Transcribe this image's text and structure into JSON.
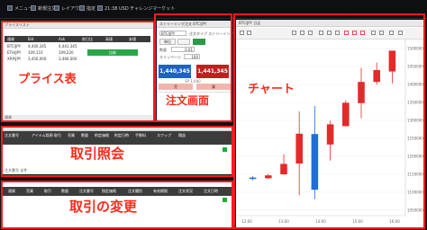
{
  "menubar": {
    "items": [
      {
        "label": "メニュー",
        "icon": "menu-icon"
      },
      {
        "label": "新規注文",
        "icon": "new-order-icon"
      },
      {
        "label": "レイアウト",
        "icon": "layout-icon"
      },
      {
        "label": "指定",
        "icon": "gear-icon"
      },
      {
        "label": "21:38 USD チャレンジマーケット",
        "icon": "clock-icon"
      }
    ]
  },
  "price_panel": {
    "title": "プライスリスト",
    "header_labels": [
      "通貨",
      "Bid",
      "Ask",
      "前日比",
      "高値",
      "安値"
    ],
    "rows": [
      {
        "pair": "BTC/JPY",
        "bid": "4,440,345",
        "ask": "4,441,345",
        "change": "+",
        "high": "",
        "low": ""
      },
      {
        "pair": "ETH/JPY",
        "bid": "109,110",
        "ask": "109,220",
        "change": "",
        "high": "",
        "low": ""
      },
      {
        "pair": "XRP/JPY",
        "bid": "3,456,000",
        "ask": "3,466,000",
        "change": "",
        "high": "",
        "low": ""
      }
    ],
    "tab_label": "通貨",
    "green_label": "比較"
  },
  "order_panel": {
    "title": "ストリーミング注文 BTC/JPY",
    "pair": "BTC/JPY",
    "order_type": "注文タイプ ストリーミング",
    "sell_price": "1,440,345",
    "buy_price": "1,441,345",
    "spread": "SP 1,000",
    "sell_label": "売",
    "buy_label": "買",
    "quantity_label": "数量",
    "quantity_value": "0.01",
    "slippage_label": "スリッページ",
    "slippage_value": "100",
    "unit_label": "単位"
  },
  "torihiki_panel": {
    "title": "約定照会",
    "headers": [
      "注文番号",
      "アイテム銘柄",
      "取引",
      "売買",
      "数量",
      "約定価格",
      "約定日時",
      "手数料",
      "スワップ",
      "損益"
    ],
    "footer": "注文番号 全件"
  },
  "change_panel": {
    "title": "注文の変更",
    "headers": [
      "通貨",
      "売買",
      "取引",
      "数量",
      "注文番号",
      "指定価格",
      "注文種別",
      "有効期限",
      "注文状況",
      "注文日時"
    ]
  },
  "chart_panel": {
    "title": "BTC/JPY 日足",
    "price_labels": [
      "1500000",
      "1450000",
      "1400000",
      "1350000",
      "1300000",
      "1250000",
      "1200000",
      "1150000",
      "1100000",
      "1050000"
    ],
    "time_labels": [
      "12:00",
      "13:00",
      "14:00",
      "15:00",
      "16:00"
    ]
  },
  "captions": {
    "price": "プライス表",
    "order": "注文画面",
    "chart": "チャート",
    "torihiki": "取引照会",
    "change": "取引の変更"
  },
  "chart_data": {
    "type": "candlestick",
    "up_color": "#e32a2a",
    "down_color": "#1f6fd1",
    "candles": [
      {
        "dir": "down",
        "open": 1141000,
        "close": 1137000,
        "high": 1145000,
        "low": 1133000
      },
      {
        "dir": "up",
        "open": 1139000,
        "close": 1147000,
        "high": 1151000,
        "low": 1137000
      },
      {
        "dir": "up",
        "open": 1150000,
        "close": 1179000,
        "high": 1206000,
        "low": 1148000
      },
      {
        "dir": "up",
        "open": 1180000,
        "close": 1263000,
        "high": 1325000,
        "low": 1092000
      },
      {
        "dir": "down",
        "open": 1262000,
        "close": 1107000,
        "high": 1340000,
        "low": 1081000
      },
      {
        "dir": "up",
        "open": 1233000,
        "close": 1289000,
        "high": 1299000,
        "low": 1188000
      },
      {
        "dir": "up",
        "open": 1284000,
        "close": 1349000,
        "high": 1356000,
        "low": 1283000
      },
      {
        "dir": "up",
        "open": 1348000,
        "close": 1407000,
        "high": 1446000,
        "low": 1306000
      },
      {
        "dir": "up",
        "open": 1407000,
        "close": 1440000,
        "high": 1461000,
        "low": 1400000
      },
      {
        "dir": "up",
        "open": 1436000,
        "close": 1494000,
        "high": 1494000,
        "low": 1403000
      }
    ]
  }
}
